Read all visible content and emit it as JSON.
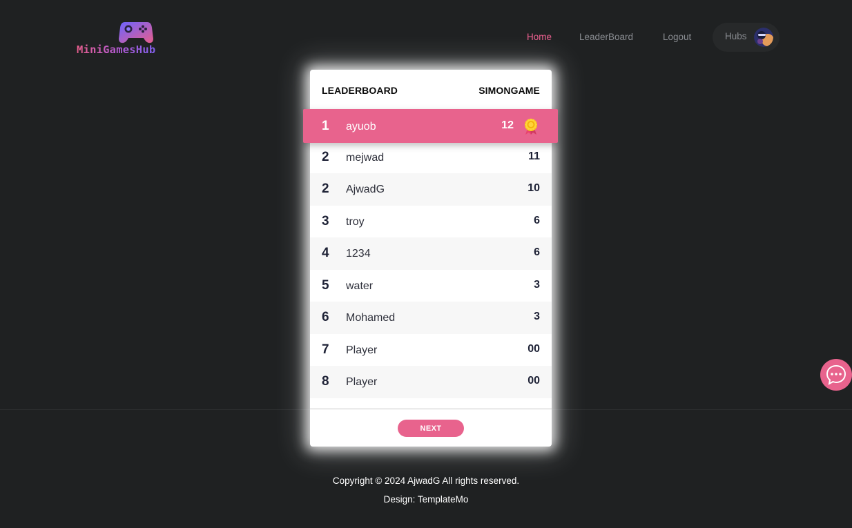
{
  "header": {
    "logo_text": "MiniGamesHub",
    "nav": {
      "home": "Home",
      "leaderboard": "LeaderBoard",
      "logout": "Logout",
      "hubs": "Hubs"
    }
  },
  "leaderboard": {
    "title": "LEADERBOARD",
    "game": "SIMONGAME",
    "rows": [
      {
        "rank": "1",
        "name": "ayuob",
        "score": "12"
      },
      {
        "rank": "2",
        "name": "mejwad",
        "score": "11"
      },
      {
        "rank": "2",
        "name": "AjwadG",
        "score": "10"
      },
      {
        "rank": "3",
        "name": "troy",
        "score": "6"
      },
      {
        "rank": "4",
        "name": "1234",
        "score": "6"
      },
      {
        "rank": "5",
        "name": "water",
        "score": "3"
      },
      {
        "rank": "6",
        "name": "Mohamed",
        "score": "3"
      },
      {
        "rank": "7",
        "name": "Player",
        "score": "00"
      },
      {
        "rank": "8",
        "name": "Player",
        "score": "00"
      }
    ],
    "next_label": "NEXT"
  },
  "footer": {
    "copyright": "Copyright © 2024 AjwadG All rights reserved.",
    "design": "Design: TemplateMo"
  },
  "colors": {
    "accent": "#e8638d",
    "background": "#1f2122",
    "nav_active": "#ec6090",
    "nav_inactive": "#8a8d92"
  },
  "icons": {
    "logo": "gamepad-icon",
    "medal": "gold-medal-icon",
    "avatar": "user-avatar",
    "chat": "chat-bubble-icon"
  }
}
